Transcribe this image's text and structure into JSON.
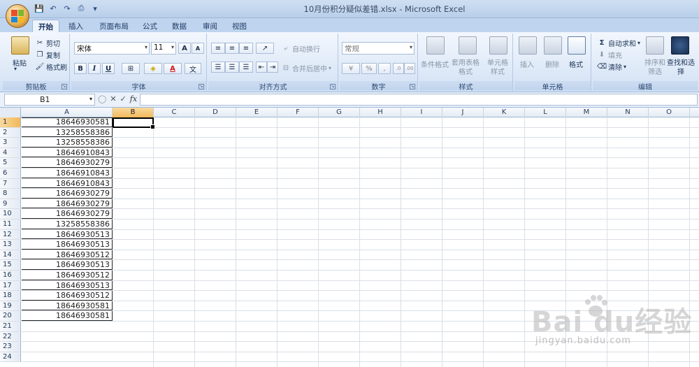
{
  "window": {
    "title": "10月份积分疑似差错.xlsx - Microsoft Excel"
  },
  "tabs": [
    "开始",
    "插入",
    "页面布局",
    "公式",
    "数据",
    "审阅",
    "视图"
  ],
  "active_tab": "开始",
  "ribbon": {
    "clipboard": {
      "label": "剪贴板",
      "paste": "粘贴",
      "cut": "剪切",
      "copy": "复制",
      "format_painter": "格式刷"
    },
    "font": {
      "label": "字体",
      "font_name": "宋体",
      "font_size": "11",
      "bold": "B",
      "italic": "I",
      "underline": "U"
    },
    "alignment": {
      "label": "对齐方式",
      "wrap": "自动换行",
      "merge": "合并后居中"
    },
    "number": {
      "label": "数字",
      "format": "常规",
      "percent": "%"
    },
    "styles": {
      "label": "样式",
      "conditional": "条件格式",
      "table": "套用表格格式",
      "cell": "单元格样式"
    },
    "cells": {
      "label": "单元格",
      "insert": "插入",
      "delete": "删除",
      "format": "格式"
    },
    "editing": {
      "label": "编辑",
      "autosum": "自动求和",
      "fill": "填充",
      "clear": "清除",
      "sort": "排序和筛选",
      "find": "查找和选择"
    }
  },
  "formula_bar": {
    "name_box": "B1",
    "fx": "fx",
    "value": ""
  },
  "columns": [
    "A",
    "B",
    "C",
    "D",
    "E",
    "F",
    "G",
    "H",
    "I",
    "J",
    "K",
    "L",
    "M",
    "N",
    "O"
  ],
  "selected_cell": "B1",
  "row_numbers": [
    "1",
    "2",
    "3",
    "4",
    "5",
    "6",
    "7",
    "8",
    "9",
    "10",
    "11",
    "12",
    "13",
    "14",
    "15",
    "16",
    "17",
    "18",
    "19",
    "20",
    "21",
    "22",
    "23",
    "24"
  ],
  "column_a": [
    "18646930581",
    "13258558386",
    "13258558386",
    "18646910843",
    "18646930279",
    "18646910843",
    "18646910843",
    "18646930279",
    "18646930279",
    "18646930279",
    "13258558386",
    "18646930513",
    "18646930513",
    "18646930512",
    "18646930513",
    "18646930512",
    "18646930513",
    "18646930512",
    "18646930581",
    "18646930581"
  ],
  "watermark": {
    "brand": "Bai du经验",
    "url": "jingyan.baidu.com"
  }
}
